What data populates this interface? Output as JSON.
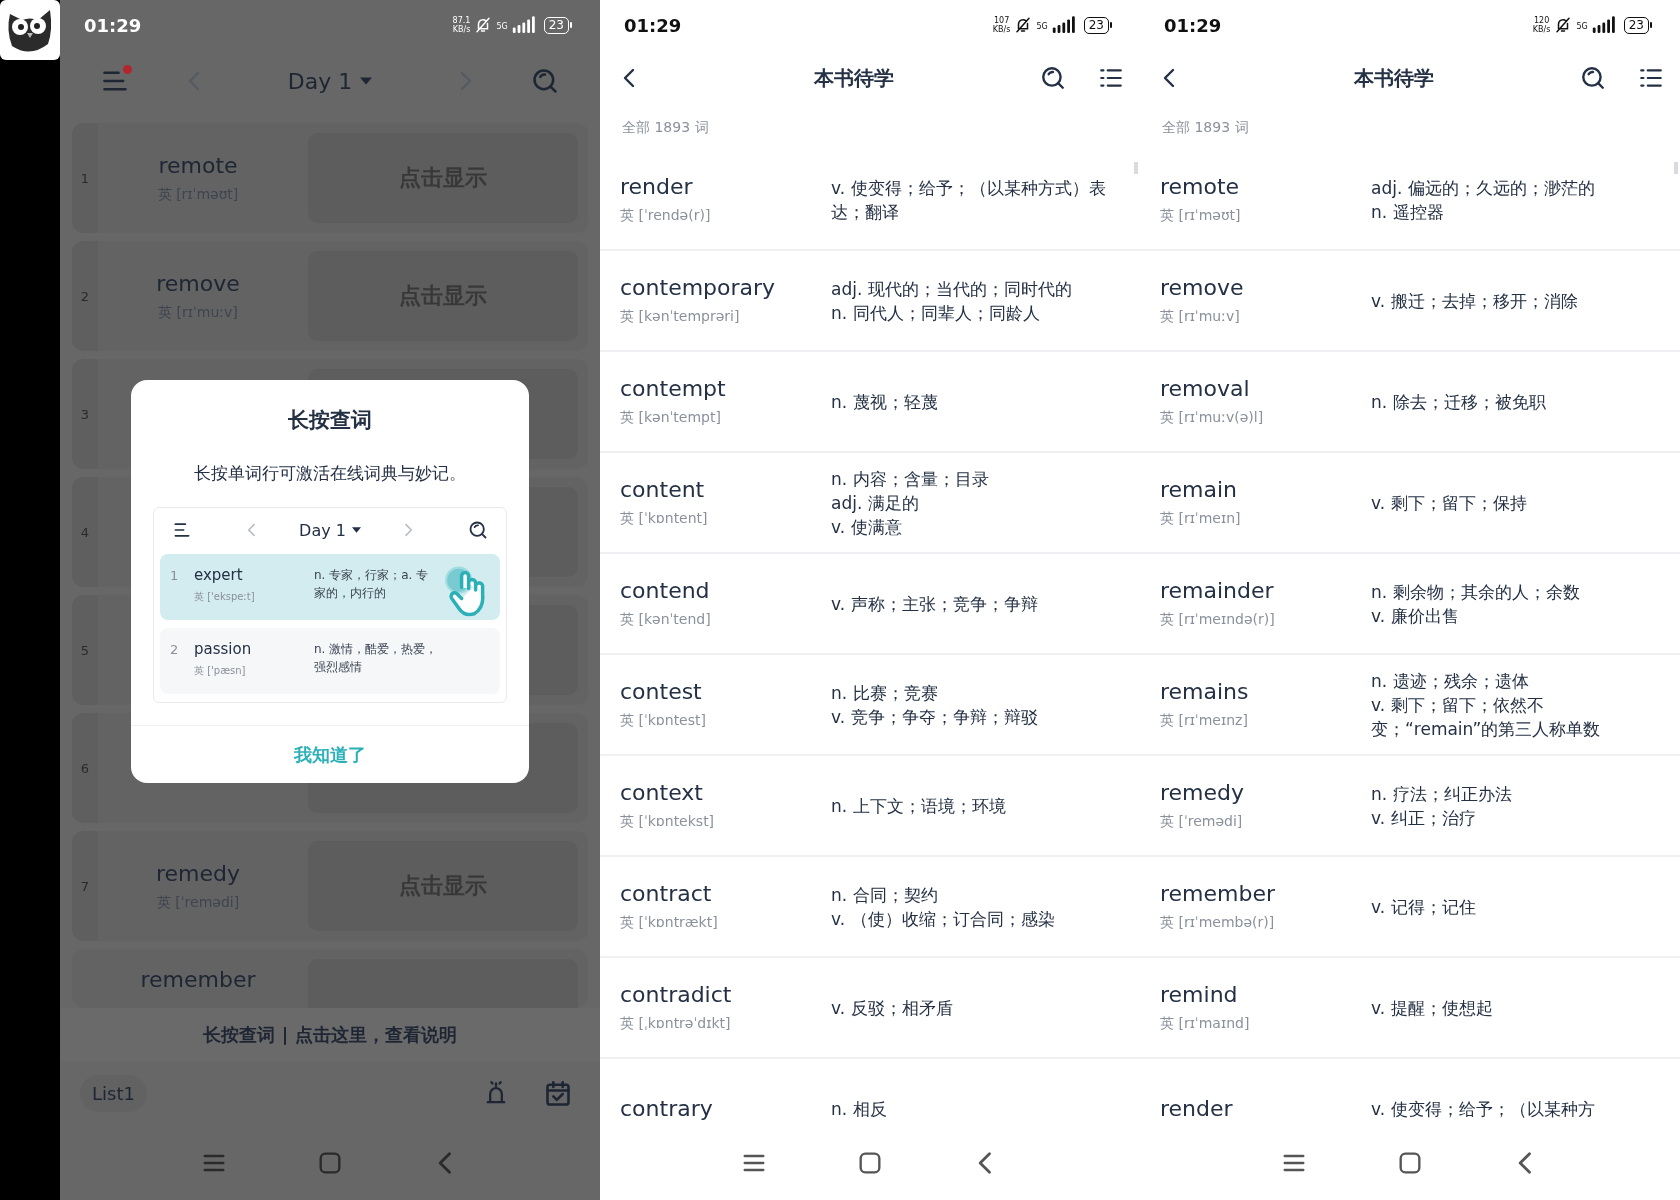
{
  "screens": [
    {
      "kind": "study",
      "status_bar": {
        "time": "01:29",
        "speed_value": "87.1",
        "speed_unit": "KB/s",
        "network": "5G",
        "battery": "23"
      },
      "header": {
        "title": "Day 1",
        "notification_dot": true
      },
      "cards": [
        {
          "number": "1",
          "word": "remote",
          "phonetic": "英 [rɪˈməʊt]",
          "reveal": "点击显示"
        },
        {
          "number": "2",
          "word": "remove",
          "phonetic": "英 [rɪˈmuːv]",
          "reveal": "点击显示"
        },
        {
          "number": "3"
        },
        {
          "number": "4"
        },
        {
          "number": "5"
        },
        {
          "number": "6"
        },
        {
          "number": "7",
          "word": "remedy",
          "phonetic": "英 [ˈremədi]",
          "reveal": "点击显示"
        },
        {
          "word": "remember"
        }
      ],
      "hint": "长按查词 | 点击这里，查看说明",
      "list_label": "List1",
      "dialog": {
        "title": "长按查词",
        "message": "长按单词行可激活在线词典与妙记。",
        "preview": {
          "title": "Day 1",
          "rows": [
            {
              "number": "1",
              "word": "expert",
              "phonetic": "英 ['ekspeːt]",
              "definition": "n. 专家，行家；a. 专家的，内行的",
              "selected": true
            },
            {
              "number": "2",
              "word": "passion",
              "phonetic": "英 ['pæsn]",
              "definition": "n. 激情，酷爱，热爱，强烈感情",
              "selected": false
            }
          ]
        },
        "button": "我知道了"
      }
    },
    {
      "kind": "wordlist",
      "status_bar": {
        "time": "01:29",
        "speed_value": "107",
        "speed_unit": "KB/s",
        "network": "5G",
        "battery": "23"
      },
      "title": "本书待学",
      "count": "全部 1893 词",
      "words": [
        {
          "word": "render",
          "phonetic": "英 [ˈrendə(r)]",
          "definitions": [
            "v. 使变得；给予；（以某种方式）表达；翻译"
          ]
        },
        {
          "word": "contemporary",
          "phonetic": "英 [kənˈtemprəri]",
          "definitions": [
            "adj. 现代的；当代的；同时代的",
            "n. 同代人；同辈人；同龄人"
          ]
        },
        {
          "word": "contempt",
          "phonetic": "英 [kənˈtempt]",
          "definitions": [
            "n. 蔑视；轻蔑"
          ]
        },
        {
          "word": "content",
          "phonetic": "英 [ˈkɒntent]",
          "definitions": [
            "n. 内容；含量；目录",
            "adj. 满足的",
            "v. 使满意"
          ]
        },
        {
          "word": "contend",
          "phonetic": "英 [kənˈtend]",
          "definitions": [
            "v. 声称；主张；竞争；争辩"
          ]
        },
        {
          "word": "contest",
          "phonetic": "英 [ˈkɒntest]",
          "definitions": [
            "n. 比赛；竞赛",
            "v. 竞争；争夺；争辩；辩驳"
          ]
        },
        {
          "word": "context",
          "phonetic": "英 [ˈkɒntekst]",
          "definitions": [
            "n. 上下文；语境；环境"
          ]
        },
        {
          "word": "contract",
          "phonetic": "英 [ˈkɒntrækt]",
          "definitions": [
            "n. 合同；契约",
            "v. （使）收缩；订合同；感染"
          ]
        },
        {
          "word": "contradict",
          "phonetic": "英 [ˌkɒntrəˈdɪkt]",
          "definitions": [
            "v. 反驳；相矛盾"
          ]
        },
        {
          "word": "contrary",
          "definitions": [
            "n. 相反"
          ]
        }
      ]
    },
    {
      "kind": "wordlist",
      "status_bar": {
        "time": "01:29",
        "speed_value": "120",
        "speed_unit": "KB/s",
        "network": "5G",
        "battery": "23"
      },
      "title": "本书待学",
      "count": "全部 1893 词",
      "words": [
        {
          "word": "remote",
          "phonetic": "英 [rɪˈməʊt]",
          "definitions": [
            "adj. 偏远的；久远的；渺茫的",
            "n. 遥控器"
          ]
        },
        {
          "word": "remove",
          "phonetic": "英 [rɪˈmuːv]",
          "definitions": [
            "v. 搬迁；去掉；移开；消除"
          ]
        },
        {
          "word": "removal",
          "phonetic": "英 [rɪˈmuːv(ə)l]",
          "definitions": [
            "n. 除去；迁移；被免职"
          ]
        },
        {
          "word": "remain",
          "phonetic": "英 [rɪˈmeɪn]",
          "definitions": [
            "v. 剩下；留下；保持"
          ]
        },
        {
          "word": "remainder",
          "phonetic": "英 [rɪˈmeɪndə(r)]",
          "definitions": [
            "n. 剩余物；其余的人；余数",
            "v. 廉价出售"
          ]
        },
        {
          "word": "remains",
          "phonetic": "英 [rɪˈmeɪnz]",
          "definitions": [
            "n. 遗迹；残余；遗体",
            "v. 剩下；留下；依然不变；“remain”的第三人称单数"
          ]
        },
        {
          "word": "remedy",
          "phonetic": "英 [ˈremədi]",
          "definitions": [
            "n. 疗法；纠正办法",
            "v. 纠正；治疗"
          ]
        },
        {
          "word": "remember",
          "phonetic": "英 [rɪˈmembə(r)]",
          "definitions": [
            "v. 记得；记住"
          ]
        },
        {
          "word": "remind",
          "phonetic": "英 [rɪˈmaɪnd]",
          "definitions": [
            "v. 提醒；使想起"
          ]
        },
        {
          "word": "render",
          "definitions": [
            "v. 使变得；给予；（以某种方"
          ]
        }
      ]
    }
  ]
}
